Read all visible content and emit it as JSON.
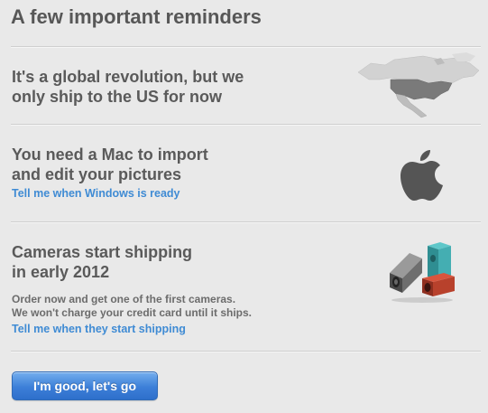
{
  "page": {
    "title": "A few important reminders"
  },
  "reminders": [
    {
      "heading_line1": "It's a global revolution, but we",
      "heading_line2": "only ship to the US for now",
      "icon": "north-america-map-icon"
    },
    {
      "heading_line1": "You need a Mac to import",
      "heading_line2": "and edit your pictures",
      "link": "Tell me when Windows is ready",
      "icon": "apple-logo-icon"
    },
    {
      "heading_line1": "Cameras start shipping",
      "heading_line2": "in early 2012",
      "body_line1": "Order now and get one of the first cameras.",
      "body_line2": "We won't charge your credit card until it ships.",
      "link": "Tell me when they start shipping",
      "icon": "lytro-cameras-icon"
    }
  ],
  "action": {
    "confirm_label": "I'm good, let's go"
  },
  "colors": {
    "background": "#e9e9e9",
    "text": "#5a5a5a",
    "link": "#3f8bd4",
    "button": "#3c7fd8"
  }
}
